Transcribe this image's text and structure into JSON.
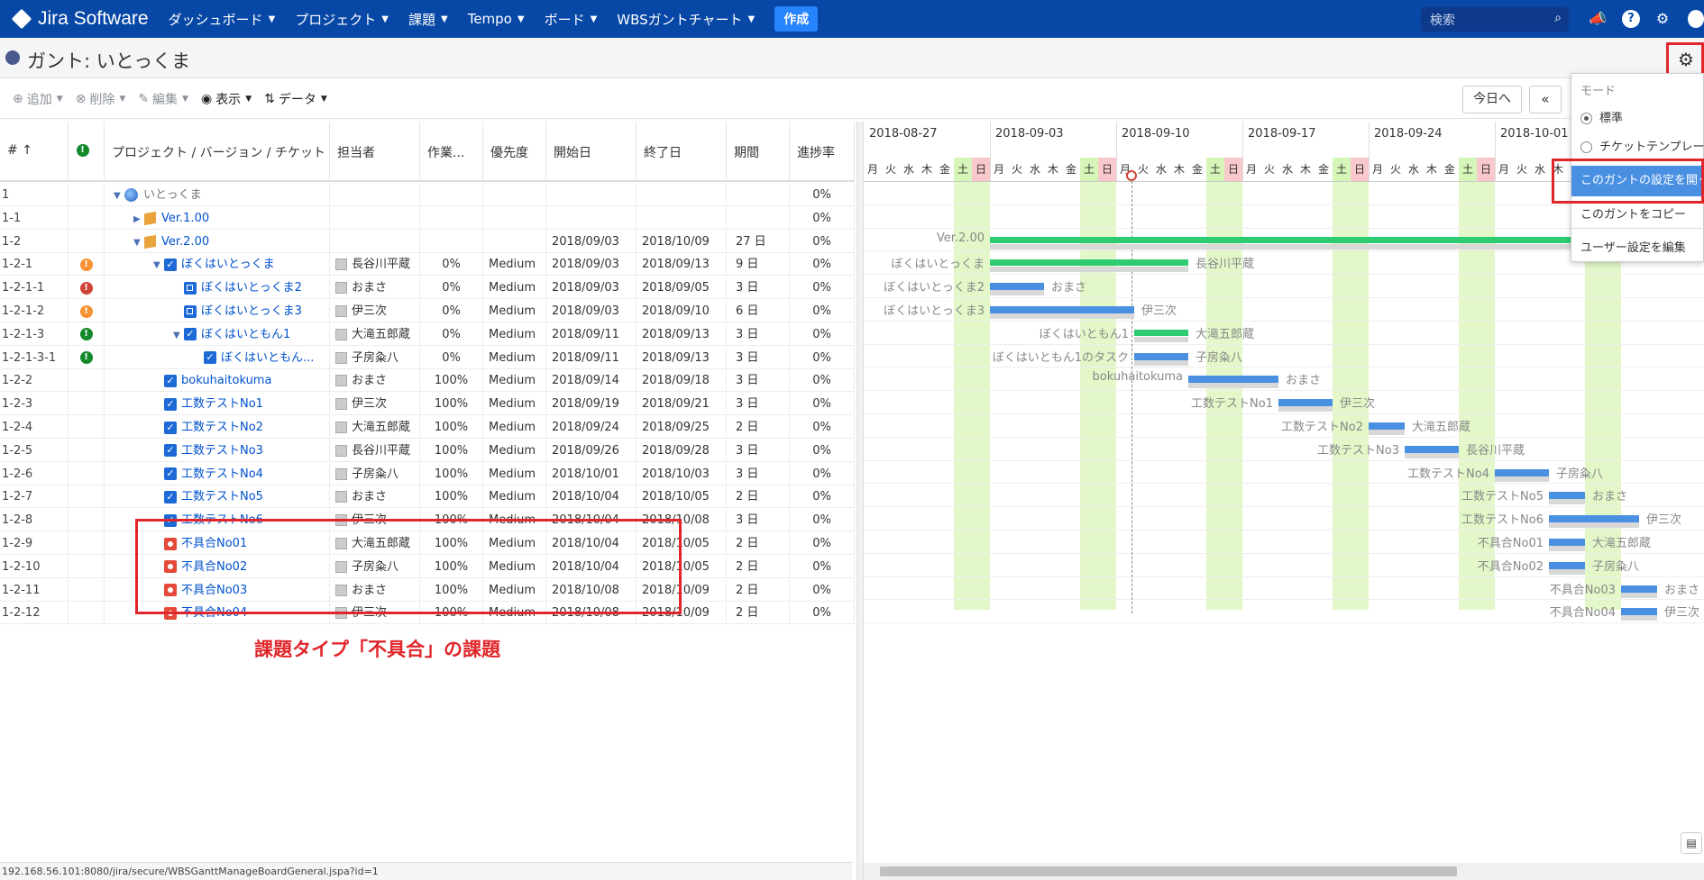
{
  "nav": {
    "app_name": "Jira Software",
    "items": [
      "ダッシュボード",
      "プロジェクト",
      "課題",
      "Tempo",
      "ボード",
      "WBSガントチャート"
    ],
    "create": "作成",
    "search_placeholder": "検索"
  },
  "page": {
    "title": "ガント: いとっくま"
  },
  "toolbar": {
    "add": "追加",
    "delete": "削除",
    "edit": "編集",
    "view": "表示",
    "data": "データ",
    "today": "今日へ",
    "prev": "«"
  },
  "columns": {
    "id": "#",
    "name": "プロジェクト / バージョン / チケット",
    "assignee": "担当者",
    "work": "作業...",
    "priority": "優先度",
    "start": "開始日",
    "end": "終了日",
    "duration": "期間",
    "progress": "進捗率"
  },
  "rows": [
    {
      "id": "1",
      "name": "いとっくま",
      "assignee": "",
      "work": "",
      "priority": "",
      "start": "",
      "end": "",
      "duration": "",
      "progress": "0%"
    },
    {
      "id": "1-1",
      "name": "Ver.1.00",
      "assignee": "",
      "work": "",
      "priority": "",
      "start": "",
      "end": "",
      "duration": "",
      "progress": "0%"
    },
    {
      "id": "1-2",
      "name": "Ver.2.00",
      "assignee": "",
      "work": "",
      "priority": "",
      "start": "2018/09/03",
      "end": "2018/10/09",
      "duration": "27 日",
      "progress": "0%"
    },
    {
      "id": "1-2-1",
      "name": "ぼくはいとっくま",
      "assignee": "長谷川平蔵",
      "work": "0%",
      "priority": "Medium",
      "start": "2018/09/03",
      "end": "2018/09/13",
      "duration": "9 日",
      "progress": "0%"
    },
    {
      "id": "1-2-1-1",
      "name": "ぼくはいとっくま2",
      "assignee": "おまさ",
      "work": "0%",
      "priority": "Medium",
      "start": "2018/09/03",
      "end": "2018/09/05",
      "duration": "3 日",
      "progress": "0%"
    },
    {
      "id": "1-2-1-2",
      "name": "ぼくはいとっくま3",
      "assignee": "伊三次",
      "work": "0%",
      "priority": "Medium",
      "start": "2018/09/03",
      "end": "2018/09/10",
      "duration": "6 日",
      "progress": "0%"
    },
    {
      "id": "1-2-1-3",
      "name": "ぼくはいともん1",
      "assignee": "大滝五郎蔵",
      "work": "0%",
      "priority": "Medium",
      "start": "2018/09/11",
      "end": "2018/09/13",
      "duration": "3 日",
      "progress": "0%"
    },
    {
      "id": "1-2-1-3-1",
      "name": "ぼくはいともん...",
      "assignee": "子房粂八",
      "work": "0%",
      "priority": "Medium",
      "start": "2018/09/11",
      "end": "2018/09/13",
      "duration": "3 日",
      "progress": "0%"
    },
    {
      "id": "1-2-2",
      "name": "bokuhaitokuma",
      "assignee": "おまさ",
      "work": "100%",
      "priority": "Medium",
      "start": "2018/09/14",
      "end": "2018/09/18",
      "duration": "3 日",
      "progress": "0%"
    },
    {
      "id": "1-2-3",
      "name": "工数テストNo1",
      "assignee": "伊三次",
      "work": "100%",
      "priority": "Medium",
      "start": "2018/09/19",
      "end": "2018/09/21",
      "duration": "3 日",
      "progress": "0%"
    },
    {
      "id": "1-2-4",
      "name": "工数テストNo2",
      "assignee": "大滝五郎蔵",
      "work": "100%",
      "priority": "Medium",
      "start": "2018/09/24",
      "end": "2018/09/25",
      "duration": "2 日",
      "progress": "0%"
    },
    {
      "id": "1-2-5",
      "name": "工数テストNo3",
      "assignee": "長谷川平蔵",
      "work": "100%",
      "priority": "Medium",
      "start": "2018/09/26",
      "end": "2018/09/28",
      "duration": "3 日",
      "progress": "0%"
    },
    {
      "id": "1-2-6",
      "name": "工数テストNo4",
      "assignee": "子房粂八",
      "work": "100%",
      "priority": "Medium",
      "start": "2018/10/01",
      "end": "2018/10/03",
      "duration": "3 日",
      "progress": "0%"
    },
    {
      "id": "1-2-7",
      "name": "工数テストNo5",
      "assignee": "おまさ",
      "work": "100%",
      "priority": "Medium",
      "start": "2018/10/04",
      "end": "2018/10/05",
      "duration": "2 日",
      "progress": "0%"
    },
    {
      "id": "1-2-8",
      "name": "工数テストNo6",
      "assignee": "伊三次",
      "work": "100%",
      "priority": "Medium",
      "start": "2018/10/04",
      "end": "2018/10/08",
      "duration": "3 日",
      "progress": "0%"
    },
    {
      "id": "1-2-9",
      "name": "不具合No01",
      "assignee": "大滝五郎蔵",
      "work": "100%",
      "priority": "Medium",
      "start": "2018/10/04",
      "end": "2018/10/05",
      "duration": "2 日",
      "progress": "0%"
    },
    {
      "id": "1-2-10",
      "name": "不具合No02",
      "assignee": "子房粂八",
      "work": "100%",
      "priority": "Medium",
      "start": "2018/10/04",
      "end": "2018/10/05",
      "duration": "2 日",
      "progress": "0%"
    },
    {
      "id": "1-2-11",
      "name": "不具合No03",
      "assignee": "おまさ",
      "work": "100%",
      "priority": "Medium",
      "start": "2018/10/08",
      "end": "2018/10/09",
      "duration": "2 日",
      "progress": "0%"
    },
    {
      "id": "1-2-12",
      "name": "不具合No04",
      "assignee": "伊三次",
      "work": "100%",
      "priority": "Medium",
      "start": "2018/10/08",
      "end": "2018/10/09",
      "duration": "2 日",
      "progress": "0%"
    }
  ],
  "annotation": "課題タイプ「不具合」の課題",
  "gantt": {
    "weeks": [
      "2018-08-27",
      "2018-09-03",
      "2018-09-10",
      "2018-09-17",
      "2018-09-24",
      "2018-10-01"
    ],
    "days": [
      "月",
      "火",
      "水",
      "木",
      "金",
      "土",
      "日"
    ],
    "labels_left": [
      "Ver.2.00",
      "ぼくはいとっくま",
      "ぼくはいとっくま2",
      "ぼくはいとっくま3",
      "ぼくはいともん1",
      "ぼくはいともん1のタスク",
      "bokuhaitokuma",
      "工数テストNo1",
      "工数テストNo2",
      "工数テストNo3",
      "工数テストNo4",
      "工数テストNo5",
      "工数テストNo6",
      "不具合No01",
      "不具合No02",
      "不具合No03",
      "不具合No04"
    ],
    "labels_right": [
      "長谷川平蔵",
      "おまさ",
      "伊三次",
      "大滝五郎蔵",
      "子房粂八",
      "おまさ",
      "伊三次",
      "大滝五郎蔵",
      "長谷川平蔵",
      "子房粂八",
      "おまさ",
      "伊三次",
      "大滝五郎蔵",
      "子房粂八",
      "おまさ",
      "伊三次"
    ]
  },
  "menu": {
    "header": "モード",
    "standard": "標準",
    "template": "チケットテンプレー",
    "open_settings": "このガントの設定を開く",
    "copy": "このガントをコピー",
    "user_settings": "ユーザー設定を編集"
  },
  "status_url": "192.168.56.101:8080/jira/secure/WBSGanttManageBoardGeneral.jspa?id=1"
}
